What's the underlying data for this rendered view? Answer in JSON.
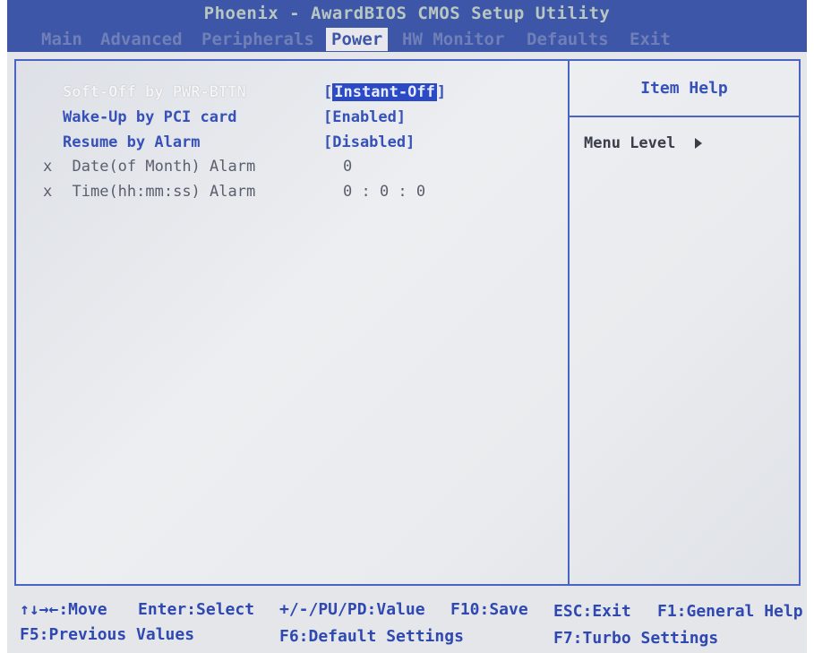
{
  "title": "Phoenix - AwardBIOS CMOS Setup Utility",
  "menu": {
    "tabs": [
      "Main",
      "Advanced",
      "Peripherals",
      "Power",
      "HW Monitor",
      "Defaults",
      "Exit"
    ],
    "active": "Power"
  },
  "settings": [
    {
      "label": "Soft-Off by PWR-BTTN",
      "value": "[Instant-Off]",
      "value_open": "[",
      "value_text": "Instant-Off",
      "value_close": "]"
    },
    {
      "label": "Wake-Up by PCI card",
      "value": "[Enabled]"
    },
    {
      "label": "Resume by Alarm",
      "value": "[Disabled]"
    },
    {
      "marker": "x",
      "label": "Date(of Month) Alarm",
      "value": "0"
    },
    {
      "marker": "x",
      "label": "Time(hh:mm:ss) Alarm",
      "value": "0 : 0 : 0"
    }
  ],
  "help": {
    "title": "Item Help",
    "menu_level": "Menu Level"
  },
  "footer": {
    "move": "↑↓→←:Move",
    "select": "Enter:Select",
    "value": "+/-/PU/PD:Value",
    "save": "F10:Save",
    "exit": "ESC:Exit",
    "general_help": "F1:General Help",
    "previous": "F5:Previous Values",
    "defaults": "F6:Default Settings",
    "turbo": "F7:Turbo Settings"
  },
  "colors": {
    "bar_blue": "#3d56a8",
    "selection_blue": "#2b4ac4",
    "text_blue": "#3651b8"
  }
}
